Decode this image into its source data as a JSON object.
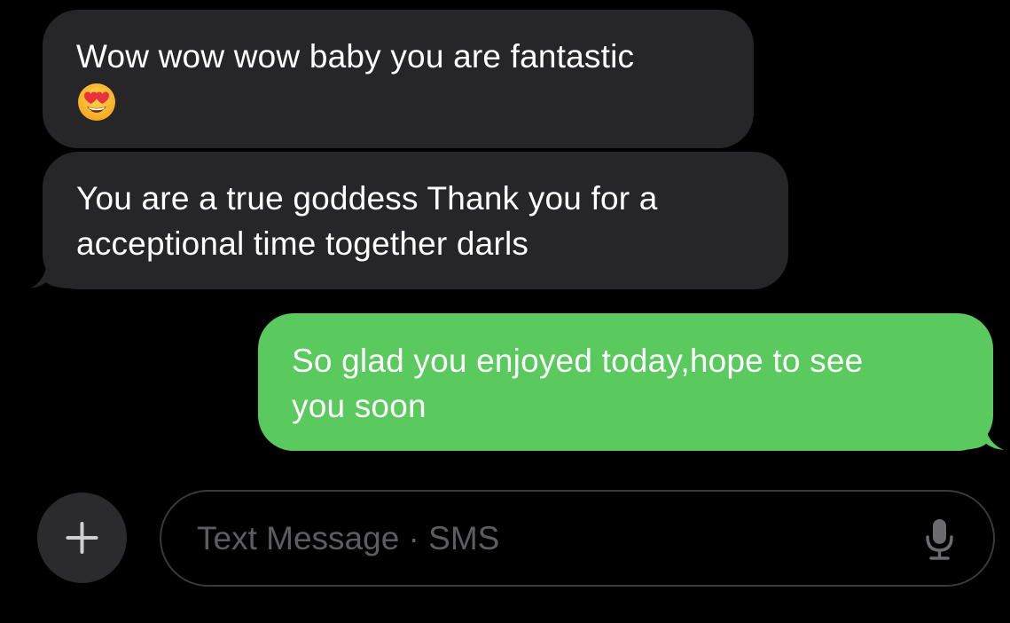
{
  "messages": [
    {
      "direction": "incoming",
      "text": "Wow wow wow baby you are fantastic",
      "emoji": "😍",
      "emoji_name": "smiling-face-with-heart-eyes"
    },
    {
      "direction": "incoming",
      "line1": "You are a true goddess Thank you for a",
      "line2": "acceptional time together darls"
    },
    {
      "direction": "outgoing",
      "line1": "So glad you enjoyed today,hope to see",
      "line2": "you soon"
    }
  ],
  "composer": {
    "placeholder": "Text Message · SMS",
    "add_icon": "plus-icon",
    "mic_icon": "microphone-icon"
  },
  "colors": {
    "background": "#000000",
    "incoming_bubble": "#262628",
    "outgoing_bubble": "#5ac95e",
    "text": "#ffffff",
    "placeholder": "#5d5d61"
  }
}
